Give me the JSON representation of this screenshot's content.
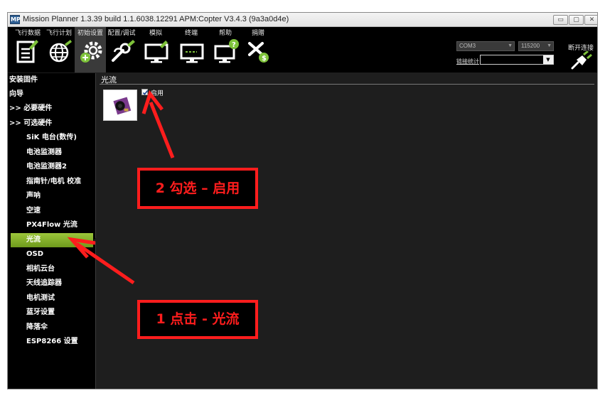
{
  "window": {
    "title": "Mission Planner 1.3.39 build 1.1.6038.12291 APM:Copter V3.4.3 (9a3a0d4e)",
    "controls": [
      "▭",
      "▢",
      "✕"
    ]
  },
  "toolbar": {
    "items": [
      {
        "label": "飞行数据",
        "icon": "flight-data-icon"
      },
      {
        "label": "飞行计划",
        "icon": "flight-plan-globe-icon"
      },
      {
        "label": "初始设置",
        "icon": "initial-setup-gear-icon"
      },
      {
        "label": "配置/调试",
        "icon": "config-wrench-icon"
      },
      {
        "label": "模拟",
        "icon": "simulation-monitor-icon"
      },
      {
        "label": "终端",
        "icon": "terminal-monitor-icon"
      },
      {
        "label": "帮助",
        "icon": "help-monitor-icon"
      },
      {
        "label": "捐赠",
        "icon": "donate-plane-icon"
      }
    ],
    "port": "COM3",
    "baud": "115200",
    "link_stats": "链接统计",
    "disconnect": "断开连接"
  },
  "sidebar": {
    "items": [
      {
        "label": "安装固件",
        "level": "top"
      },
      {
        "label": "向导",
        "level": "top"
      },
      {
        "label": ">> 必要硬件",
        "level": "top"
      },
      {
        "label": ">> 可选硬件",
        "level": "top"
      },
      {
        "label": "SiK 电台(数传)",
        "level": "sub"
      },
      {
        "label": "电池监测器",
        "level": "sub"
      },
      {
        "label": "电池监测器2",
        "level": "sub"
      },
      {
        "label": "指南针/电机 校准",
        "level": "sub"
      },
      {
        "label": "声呐",
        "level": "sub"
      },
      {
        "label": "空速",
        "level": "sub"
      },
      {
        "label": "PX4Flow 光流",
        "level": "sub"
      },
      {
        "label": "光流",
        "level": "sub",
        "active": true
      },
      {
        "label": "OSD",
        "level": "sub"
      },
      {
        "label": "相机云台",
        "level": "sub"
      },
      {
        "label": "天线追踪器",
        "level": "sub"
      },
      {
        "label": "电机测试",
        "level": "sub"
      },
      {
        "label": "蓝牙设置",
        "level": "sub"
      },
      {
        "label": "降落伞",
        "level": "sub"
      },
      {
        "label": "ESP8266 设置",
        "level": "sub"
      }
    ]
  },
  "main": {
    "title": "光流",
    "enable_label": "启用",
    "enable_checked": true
  },
  "annotations": {
    "step2": "2 勾选 – 启用",
    "step1": "1 点击 - 光流",
    "color": "#ff1d1d"
  },
  "colors": {
    "toolbar_bg": "#000000",
    "panel_bg": "#1e1e1e",
    "active_green": "#86b32b",
    "annotation_red": "#ff1d1d"
  }
}
